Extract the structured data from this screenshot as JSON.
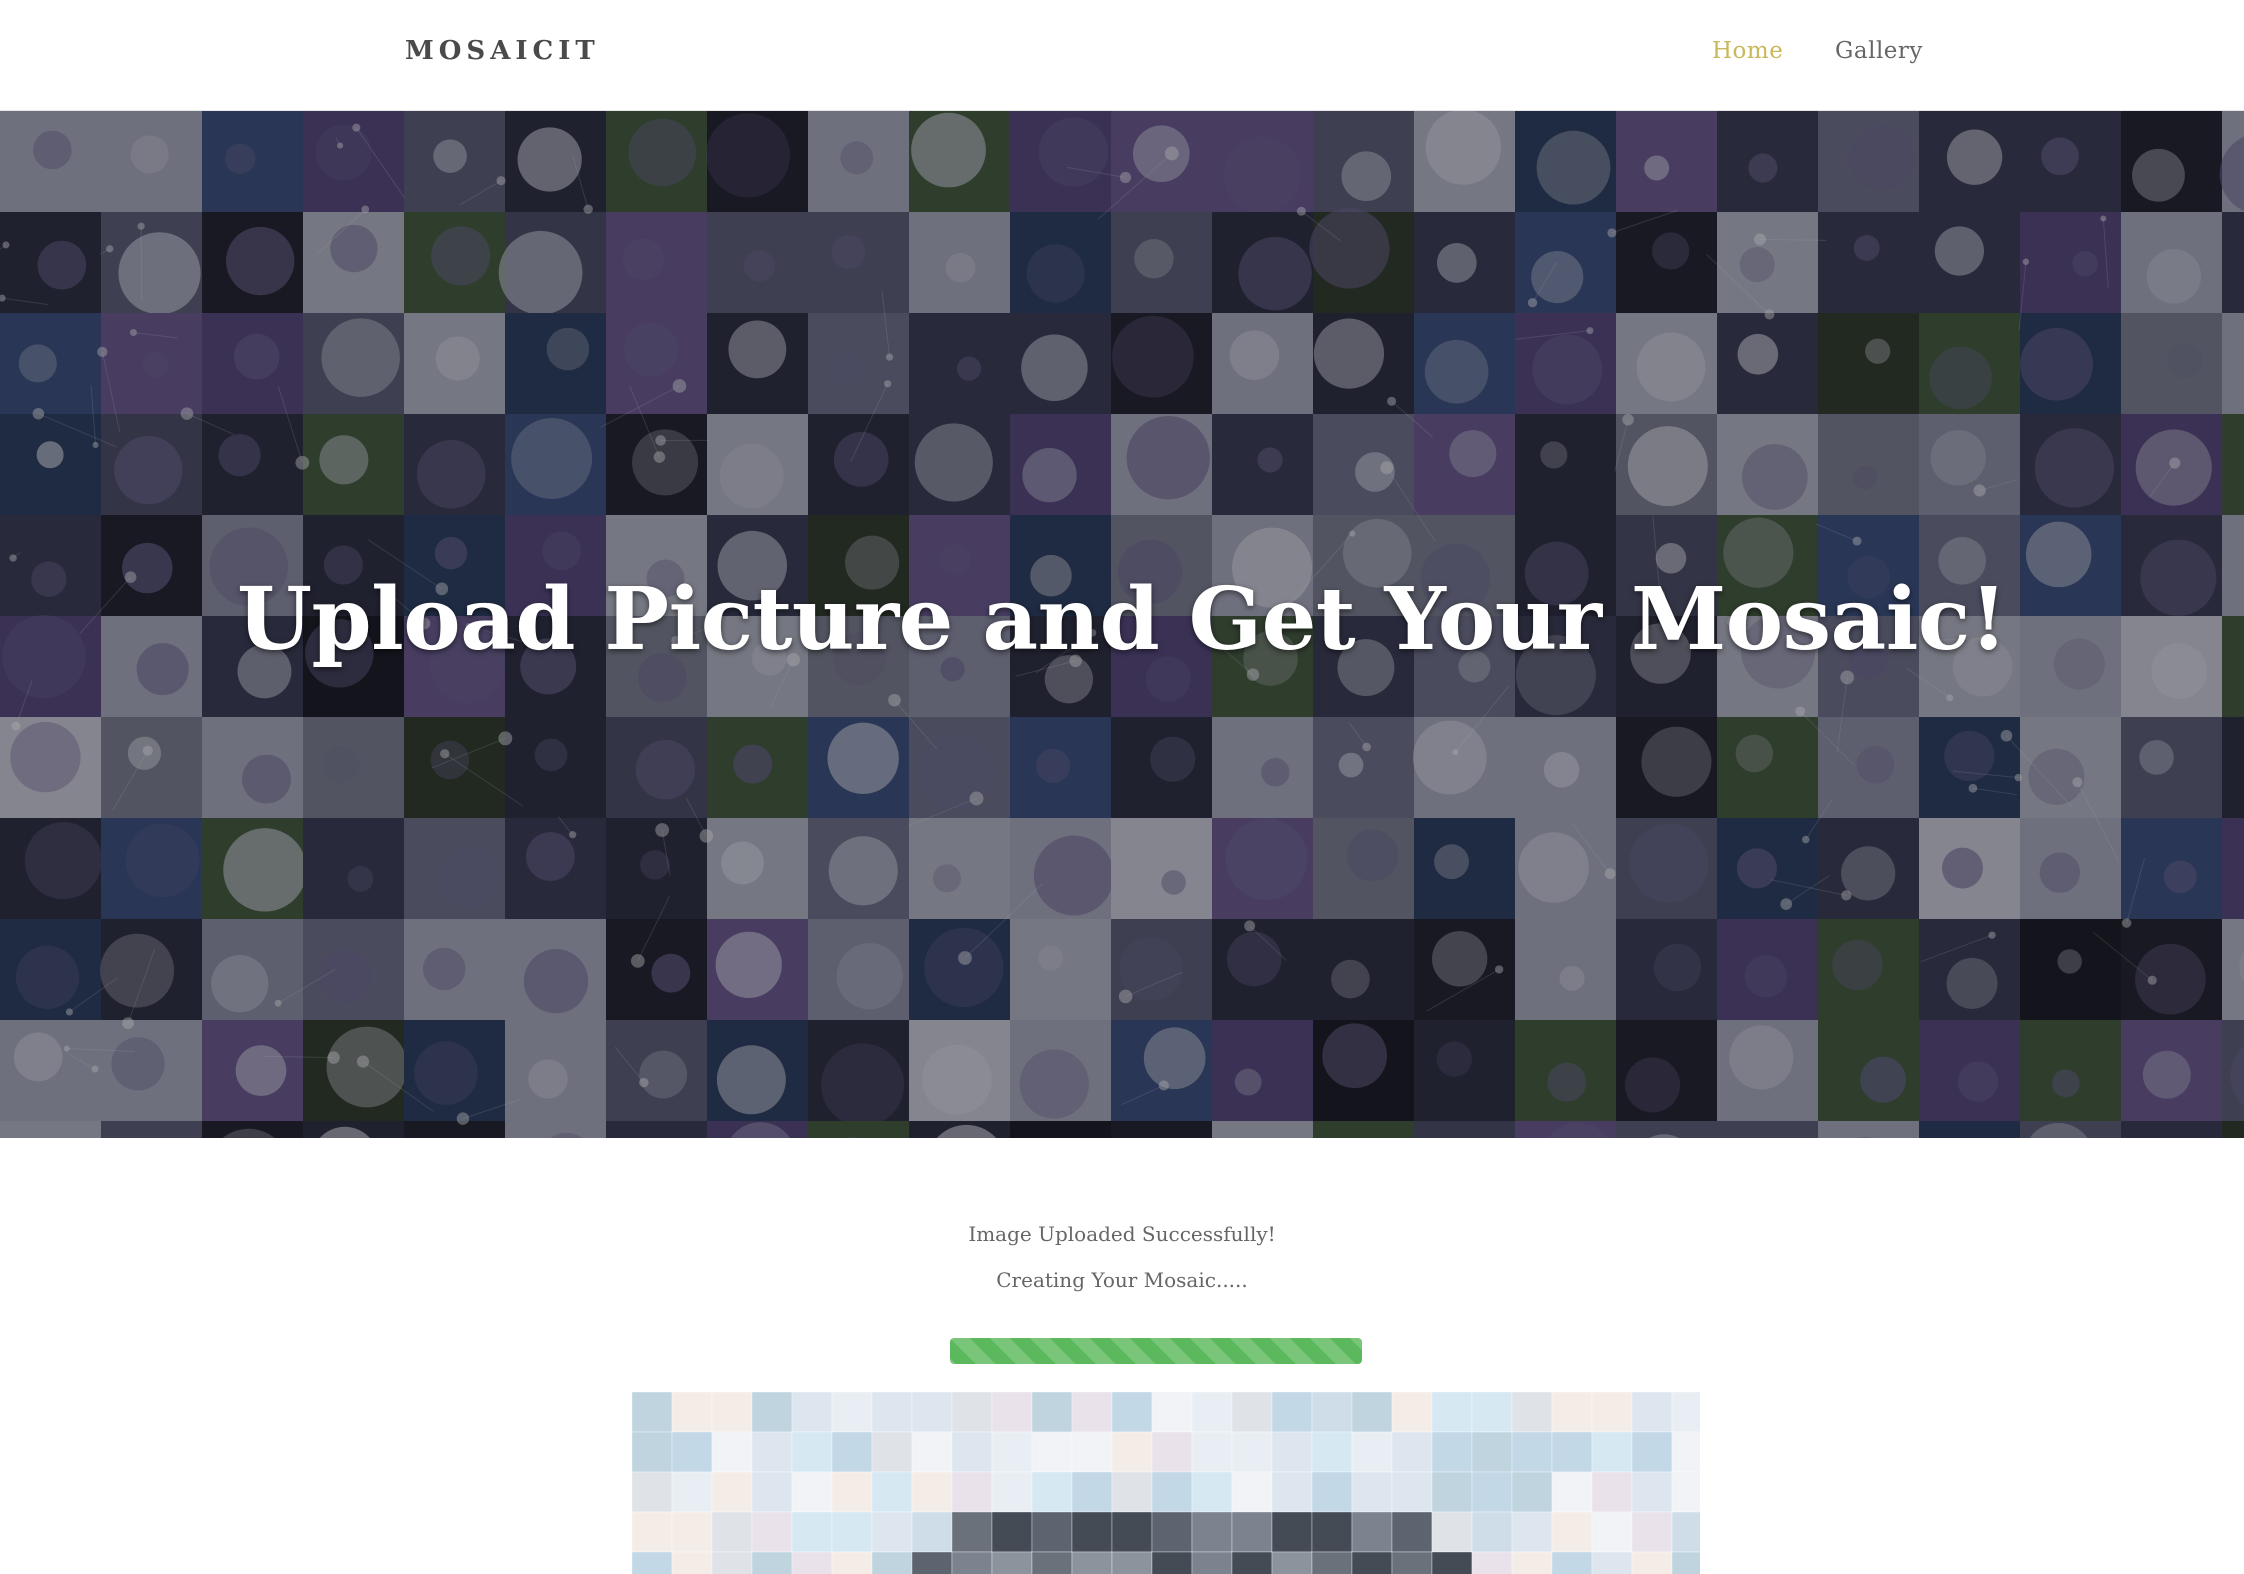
{
  "header": {
    "brand": "MOSAICIT",
    "nav": {
      "home_label": "Home",
      "gallery_label": "Gallery"
    }
  },
  "hero": {
    "title": "Upload Picture and Get Your Mosaic!"
  },
  "status": {
    "uploaded_text": "Image Uploaded Successfully!",
    "creating_text": "Creating Your Mosaic....."
  },
  "progress": {
    "percent": 100
  },
  "colors": {
    "nav_active": "#c9b85a",
    "nav_inactive": "#666666",
    "progress_bar": "#5cb85c",
    "brand": "#4a4a4a"
  }
}
